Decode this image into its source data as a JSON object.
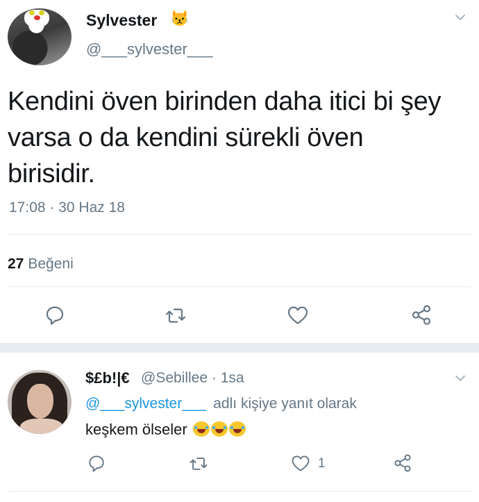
{
  "main_tweet": {
    "display_name": "Sylvester",
    "name_emoji": "😾",
    "handle": "@___sylvester___",
    "text": "Kendini öven birinden daha itici bi şey varsa o da kendini sürekli öven birisidir.",
    "timestamp": "17:08 · 30 Haz 18",
    "likes_count": "27",
    "likes_label": "Beğeni"
  },
  "reply_tweet": {
    "display_name": "$£b!|€",
    "handle_time": "@Sebillee · 1sa",
    "reply_mention": "@___sylvester___",
    "reply_label": "adlı kişiye yanıt olarak",
    "text": "keşkem ölseler",
    "like_count": "1"
  },
  "icons": {
    "reply": "reply-icon",
    "retweet": "retweet-icon",
    "like": "heart-icon",
    "share": "share-icon",
    "menu": "chevron-down-icon"
  },
  "colors": {
    "text": "#14171a",
    "secondary": "#657786",
    "link": "#1b95e0",
    "divider": "#e6ecf0"
  }
}
